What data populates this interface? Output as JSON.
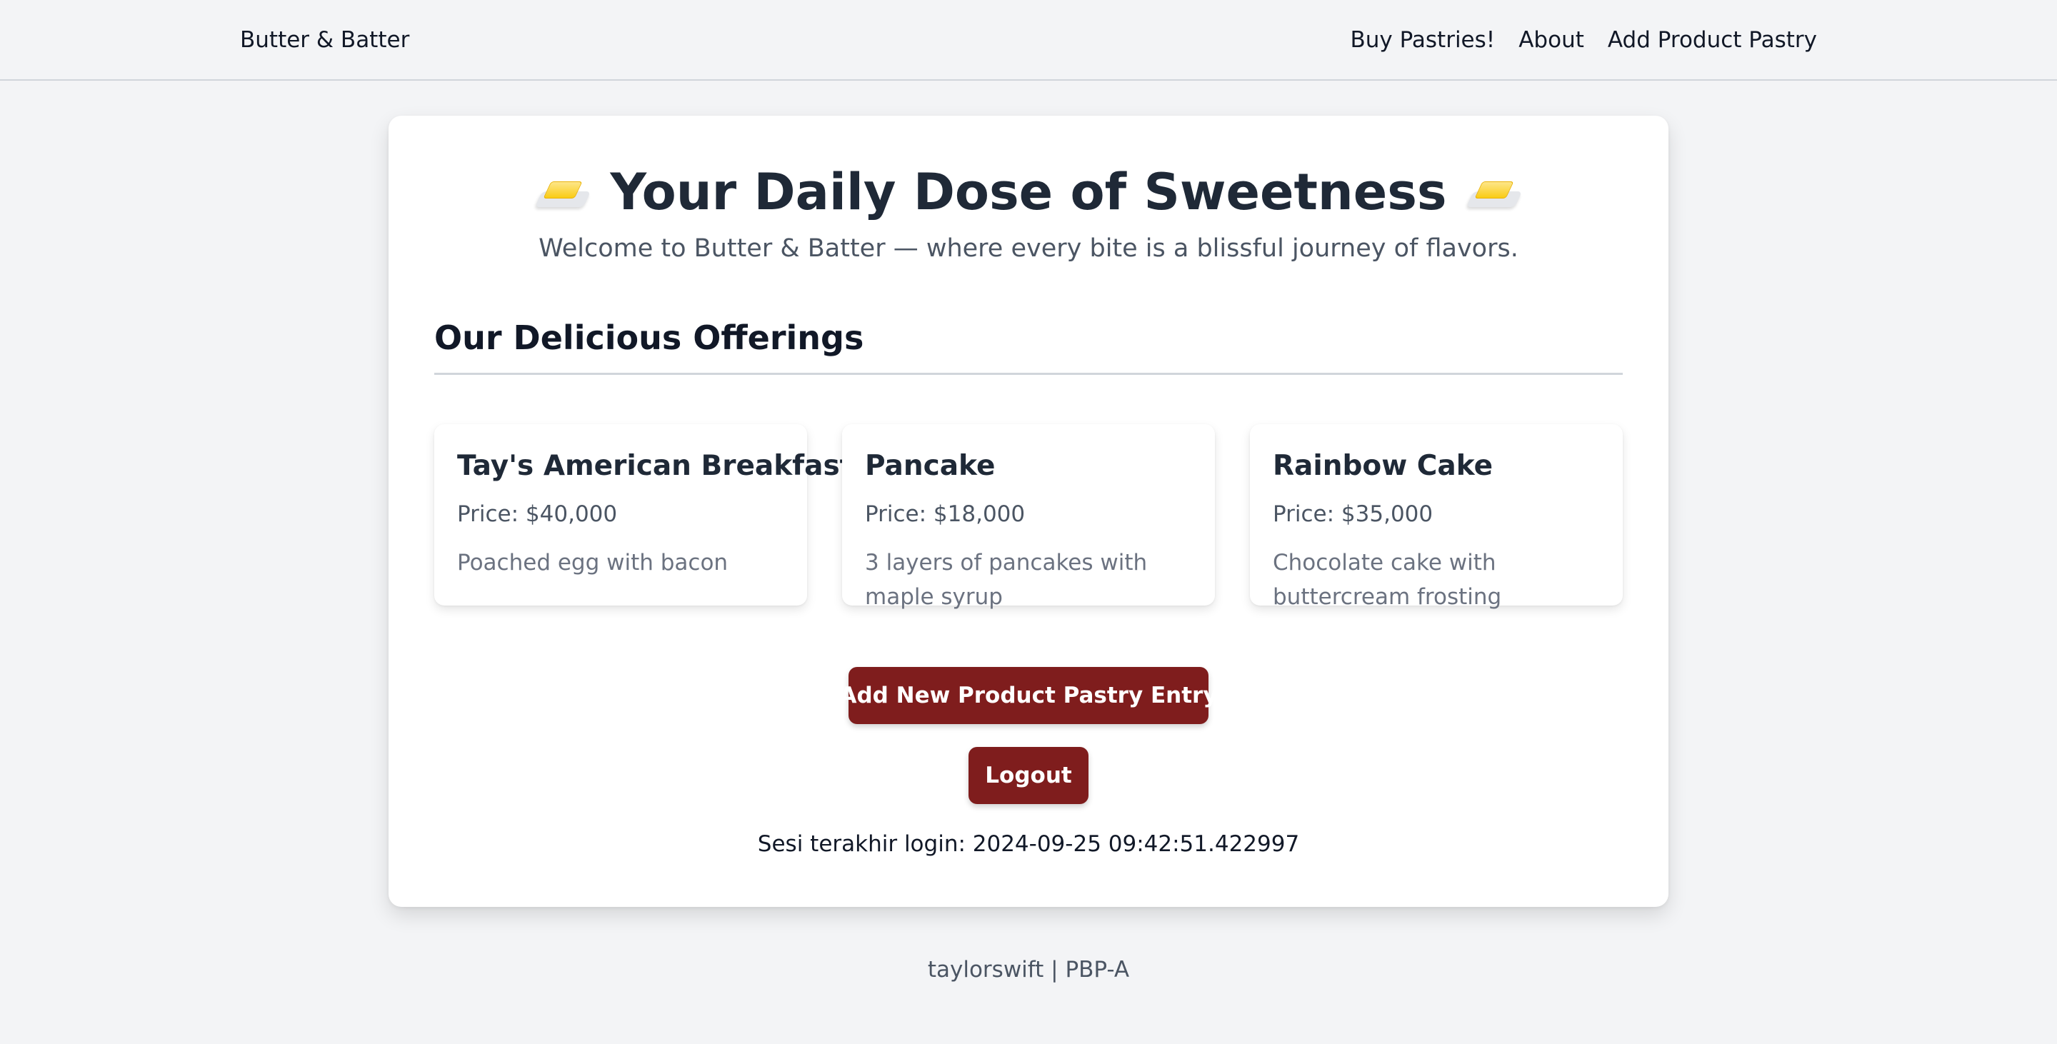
{
  "navbar": {
    "brand": "Butter & Batter",
    "links": [
      "Buy Pastries!",
      "About",
      "Add Product Pastry"
    ]
  },
  "hero": {
    "title": "Your Daily Dose of Sweetness",
    "icon": "butter-emoji",
    "subtitle": "Welcome to Butter & Batter — where every bite is a blissful journey of flavors."
  },
  "section": {
    "title": "Our Delicious Offerings"
  },
  "products": [
    {
      "name": "Tay's American Breakfast",
      "price": "Price: $40,000",
      "description": "Poached egg with bacon"
    },
    {
      "name": "Pancake",
      "price": "Price: $18,000",
      "description": "3 layers of pancakes with maple syrup"
    },
    {
      "name": "Rainbow Cake",
      "price": "Price: $35,000",
      "description": "Chocolate cake with buttercream frosting"
    }
  ],
  "actions": {
    "add_label": "Add New Product Pastry Entry",
    "logout_label": "Logout"
  },
  "session": {
    "last_login": "Sesi terakhir login: 2024-09-25 09:42:51.422997"
  },
  "footer": {
    "text": "taylorswift | PBP-A"
  },
  "colors": {
    "accent": "#7f1d1d",
    "background": "#f3f4f6",
    "card": "#ffffff"
  }
}
